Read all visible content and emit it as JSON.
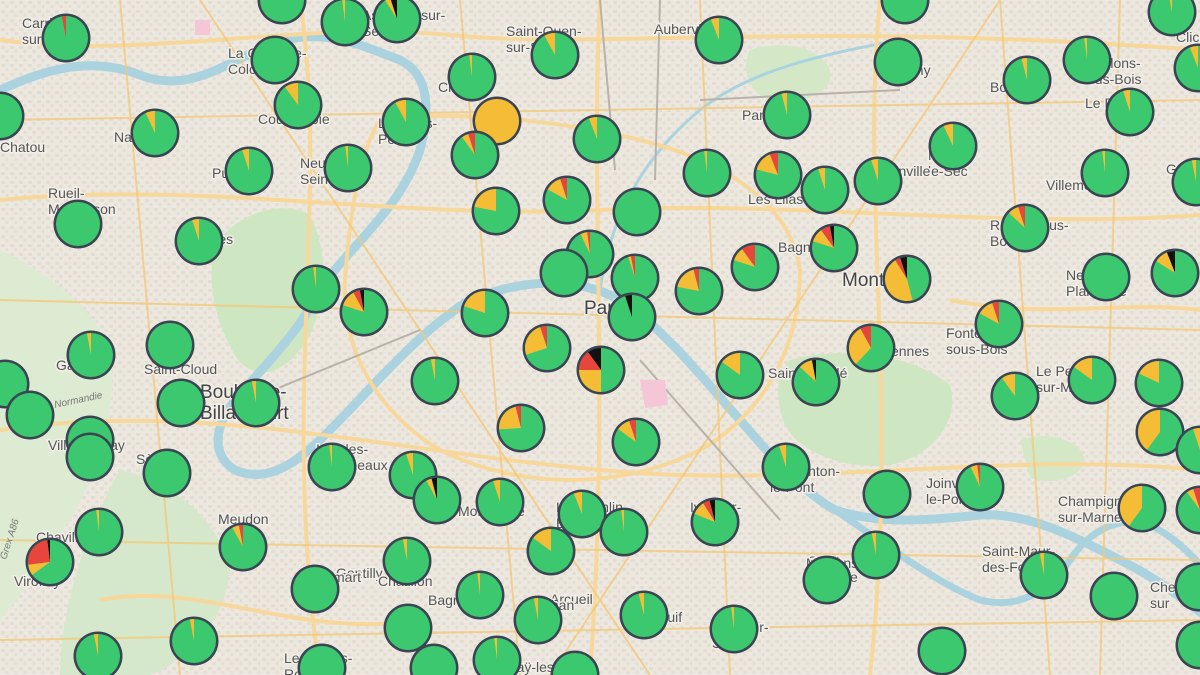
{
  "colors": {
    "ok": "#3cc86f",
    "warn": "#f5bd35",
    "bad": "#e8453c",
    "down": "#111111",
    "ring": "#3a4452"
  },
  "road_labels": [
    "Normandie",
    "Grex A86"
  ],
  "places": [
    {
      "name": "Carrières-sur-Seine",
      "lines": [
        "Carrières-",
        "sur-Seine"
      ]
    },
    {
      "name": "La Garenne-Colombes",
      "lines": [
        "La Garenne-",
        "Colombes"
      ]
    },
    {
      "name": "Asnières-sur-Seine",
      "lines": [
        "Asnières-sur-",
        "Seine"
      ]
    },
    {
      "name": "Saint-Ouen-sur-Seine",
      "lines": [
        "Saint-Ouen-",
        "sur-Seine"
      ]
    },
    {
      "name": "Aubervilliers",
      "lines": [
        "Aubervilliers"
      ]
    },
    {
      "name": "Livry",
      "lines": [
        "Livry"
      ]
    },
    {
      "name": "Clic",
      "lines": [
        "Clic"
      ]
    },
    {
      "name": "Les Pavillons-sous-Bois",
      "lines": [
        "Les",
        "Pavillons-",
        "sous-Bois"
      ]
    },
    {
      "name": "Bobigny",
      "lines": [
        "Bobigny"
      ]
    },
    {
      "name": "Bondy",
      "lines": [
        "Bondy"
      ]
    },
    {
      "name": "Le Raincy",
      "lines": [
        "Le Raincy"
      ]
    },
    {
      "name": "Courbevoie",
      "lines": [
        "Courbevoie"
      ]
    },
    {
      "name": "Levallois-Perret",
      "lines": [
        "Levallois-",
        "Perret"
      ]
    },
    {
      "name": "Clichy",
      "lines": [
        "Clichy"
      ]
    },
    {
      "name": "Pantin",
      "lines": [
        "Pantin"
      ]
    },
    {
      "name": "Noisy-le-Sec",
      "lines": [
        "Noisy-",
        "le-Sec"
      ]
    },
    {
      "name": "Romainville",
      "lines": [
        "Romainville"
      ]
    },
    {
      "name": "Villemomble",
      "lines": [
        "Villemomble"
      ]
    },
    {
      "name": "Gagny",
      "lines": [
        "Gag"
      ]
    },
    {
      "name": "Nanterre",
      "lines": [
        "Nanterre"
      ]
    },
    {
      "name": "Puteaux",
      "lines": [
        "Puteaux"
      ]
    },
    {
      "name": "Neuilly-sur-Seine",
      "lines": [
        "Neuilly-sur-",
        "Seine"
      ]
    },
    {
      "name": "Chatou",
      "lines": [
        "Chatou"
      ]
    },
    {
      "name": "Rueil-Malmaison",
      "lines": [
        "Rueil-",
        "Malmaison"
      ]
    },
    {
      "name": "Suresnes",
      "lines": [
        "Suresnes"
      ]
    },
    {
      "name": "Les Lilas",
      "lines": [
        "Les Lilas"
      ]
    },
    {
      "name": "Bagnolet",
      "lines": [
        "Bagnolet"
      ]
    },
    {
      "name": "Montreuil",
      "lines": [
        "Montreuil"
      ],
      "big": true
    },
    {
      "name": "Rosny-sous-Bois",
      "lines": [
        "Rosny-sous-",
        "Bois"
      ]
    },
    {
      "name": "Neuilly-Plaisance",
      "lines": [
        "Neuilly-",
        "Plaisance"
      ]
    },
    {
      "name": "Paris",
      "lines": [
        "Paris"
      ],
      "big": true
    },
    {
      "name": "Fontenay-sous-Bois",
      "lines": [
        "Fontenay-",
        "sous-Bois"
      ]
    },
    {
      "name": "Vincennes",
      "lines": [
        "Vincennes"
      ]
    },
    {
      "name": "Saint-Mandé",
      "lines": [
        "Saint-Mandé"
      ]
    },
    {
      "name": "Garches",
      "lines": [
        "Garches"
      ]
    },
    {
      "name": "Saint-Cloud",
      "lines": [
        "Saint-Cloud"
      ]
    },
    {
      "name": "Boulogne-Billancourt",
      "lines": [
        "Boulogne-",
        "Billancourt"
      ],
      "big": true
    },
    {
      "name": "Le Perreux-sur-Marne",
      "lines": [
        "Le Perreux-",
        "sur-Marne"
      ]
    },
    {
      "name": "Ville-d'Avray",
      "lines": [
        "Ville-d'Avray"
      ]
    },
    {
      "name": "Sèvres",
      "lines": [
        "Sèvres"
      ]
    },
    {
      "name": "Issy-les-Moulineaux",
      "lines": [
        "Issy-les-",
        "Moulineaux"
      ]
    },
    {
      "name": "Charenton-le-Pont",
      "lines": [
        "Charenton-",
        "le-Pont"
      ]
    },
    {
      "name": "Joinville-le-Pont",
      "lines": [
        "Joinville-",
        "le-Pont"
      ]
    },
    {
      "name": "Champigny-sur-Marne",
      "lines": [
        "Champigny-",
        "sur-Marne"
      ]
    },
    {
      "name": "Meudon",
      "lines": [
        "Meudon"
      ]
    },
    {
      "name": "Malakoff",
      "lines": [
        "Malakoff"
      ]
    },
    {
      "name": "Montrouge",
      "lines": [
        "Montrouge"
      ]
    },
    {
      "name": "Le Kremlin-Bicêtre",
      "lines": [
        "Le Kremlin-",
        "Bicêtre"
      ]
    },
    {
      "name": "Ivry-sur-Seine",
      "lines": [
        "Ivry-sur-",
        "Seine"
      ]
    },
    {
      "name": "Saint-Maurice",
      "lines": [
        "Saint-",
        "Maurice"
      ]
    },
    {
      "name": "Gentilly",
      "lines": [
        "Gentilly"
      ]
    },
    {
      "name": "Maisons-Alfort",
      "lines": [
        "Maisons-",
        "Alfort"
      ]
    },
    {
      "name": "Saint-Maur-des-Fossés",
      "lines": [
        "Saint-Maur-",
        "des-Fossés"
      ]
    },
    {
      "name": "Chennevières-sur-Marne",
      "lines": [
        "Che",
        "sur"
      ]
    },
    {
      "name": "Chaville",
      "lines": [
        "Chaville"
      ]
    },
    {
      "name": "Viroflay",
      "lines": [
        "Viroflay"
      ]
    },
    {
      "name": "Clamart",
      "lines": [
        "Clamart"
      ]
    },
    {
      "name": "Châtillon",
      "lines": [
        "Châtillon"
      ]
    },
    {
      "name": "Bagneux",
      "lines": [
        "Bagneux"
      ]
    },
    {
      "name": "Arcueil",
      "lines": [
        "Arcueil"
      ]
    },
    {
      "name": "Cachan",
      "lines": [
        "Cachan"
      ]
    },
    {
      "name": "Villejuif",
      "lines": [
        "Villejuif"
      ]
    },
    {
      "name": "Vitry-sur-Seine",
      "lines": [
        "Vitry-sur-",
        "Seine"
      ]
    },
    {
      "name": "Le Plessis-Robinson",
      "lines": [
        "Le Plessis-",
        "Robinson"
      ]
    },
    {
      "name": "L'Haÿ-les-Roses",
      "lines": [
        "L'Haÿ-les-",
        "Roses"
      ]
    }
  ],
  "markers": [
    {
      "id": "m1",
      "warn": 0.02,
      "bad": 0,
      "down": 0
    },
    {
      "id": "m2",
      "warn": 0.02,
      "bad": 0,
      "down": 0
    },
    {
      "id": "m3",
      "warn": 0.04,
      "bad": 0,
      "down": 0.05
    },
    {
      "id": "m4",
      "warn": 0.08,
      "bad": 0,
      "down": 0
    },
    {
      "id": "m5",
      "warn": 0.06,
      "bad": 0,
      "down": 0
    },
    {
      "id": "m6",
      "warn": 0,
      "bad": 0,
      "down": 0
    },
    {
      "id": "m7",
      "warn": 0.03,
      "bad": 0,
      "down": 0
    },
    {
      "id": "m8",
      "warn": 0.02,
      "bad": 0,
      "down": 0
    },
    {
      "id": "m9",
      "warn": 0.06,
      "bad": 0,
      "down": 0
    },
    {
      "id": "m10",
      "warn": 0.05,
      "bad": 0,
      "down": 0
    },
    {
      "id": "m11",
      "warn": 0.04,
      "bad": 0,
      "down": 0
    },
    {
      "id": "m12",
      "warn": 0,
      "bad": 0,
      "down": 0
    },
    {
      "id": "m13",
      "warn": 0.04,
      "bad": 0,
      "down": 0
    },
    {
      "id": "m14",
      "warn": 0.07,
      "bad": 0,
      "down": 0
    },
    {
      "id": "m15",
      "warn": 0.06,
      "bad": 0,
      "down": 0
    },
    {
      "id": "m16",
      "warn": 0.02,
      "bad": 0,
      "down": 0
    },
    {
      "id": "m17",
      "warn": 1,
      "bad": 0,
      "down": 0
    },
    {
      "id": "m18",
      "warn": 0.08,
      "bad": 0,
      "down": 0
    },
    {
      "id": "m19",
      "warn": 0.1,
      "bad": 0,
      "down": 0
    },
    {
      "id": "m20",
      "warn": 0,
      "bad": 0,
      "down": 0
    },
    {
      "id": "m21",
      "warn": 0,
      "bad": 0.03,
      "down": 0
    },
    {
      "id": "m22",
      "warn": 0.07,
      "bad": 0,
      "down": 0
    },
    {
      "id": "m23",
      "warn": 0.05,
      "bad": 0,
      "down": 0
    },
    {
      "id": "m24",
      "warn": 0.02,
      "bad": 0,
      "down": 0
    },
    {
      "id": "m25",
      "warn": 0.05,
      "bad": 0.05,
      "down": 0
    },
    {
      "id": "m26",
      "warn": 0.12,
      "bad": 0.05,
      "down": 0
    },
    {
      "id": "m27",
      "warn": 0.22,
      "bad": 0,
      "down": 0
    },
    {
      "id": "m28",
      "warn": 0,
      "bad": 0,
      "down": 0
    },
    {
      "id": "m29",
      "warn": 0.02,
      "bad": 0,
      "down": 0
    },
    {
      "id": "m30",
      "warn": 0.15,
      "bad": 0.06,
      "down": 0
    },
    {
      "id": "m31",
      "warn": 0.05,
      "bad": 0,
      "down": 0
    },
    {
      "id": "m32",
      "warn": 0.05,
      "bad": 0,
      "down": 0
    },
    {
      "id": "m33",
      "warn": 0.02,
      "bad": 0,
      "down": 0
    },
    {
      "id": "m34",
      "warn": 0.08,
      "bad": 0.05,
      "down": 0
    },
    {
      "id": "m35",
      "warn": 0.03,
      "bad": 0,
      "down": 0
    },
    {
      "id": "m36",
      "warn": 0,
      "bad": 0,
      "down": 0
    },
    {
      "id": "m37",
      "warn": 0.1,
      "bad": 0,
      "down": 0.06
    },
    {
      "id": "m38",
      "warn": 0.1,
      "bad": 0.07,
      "down": 0.03
    },
    {
      "id": "m39",
      "warn": 0.45,
      "bad": 0.04,
      "down": 0.05
    },
    {
      "id": "m40",
      "warn": 0.1,
      "bad": 0.1,
      "down": 0
    },
    {
      "id": "m41",
      "warn": 0.18,
      "bad": 0.04,
      "down": 0
    },
    {
      "id": "m42",
      "warn": 0.02,
      "bad": 0.03,
      "down": 0
    },
    {
      "id": "m43",
      "warn": 0.05,
      "bad": 0.02,
      "down": 0
    },
    {
      "id": "m44",
      "warn": 0,
      "bad": 0,
      "down": 0
    },
    {
      "id": "m45",
      "warn": 0,
      "bad": 0,
      "down": 0.05
    },
    {
      "id": "m46",
      "warn": 0.02,
      "bad": 0,
      "down": 0
    },
    {
      "id": "m47",
      "warn": 0.05,
      "bad": 0,
      "down": 0
    },
    {
      "id": "m48",
      "warn": 0,
      "bad": 0,
      "down": 0
    },
    {
      "id": "m49",
      "warn": 0.05,
      "bad": 0.06,
      "down": 0
    },
    {
      "id": "m50",
      "warn": 0.12,
      "bad": 0.05,
      "down": 0.03
    },
    {
      "id": "m51",
      "warn": 0.2,
      "bad": 0,
      "down": 0
    },
    {
      "id": "m52",
      "warn": 0.25,
      "bad": 0.05,
      "down": 0
    },
    {
      "id": "m53",
      "warn": 0.25,
      "bad": 0.15,
      "down": 0.1
    },
    {
      "id": "m54",
      "warn": 0.15,
      "bad": 0,
      "down": 0
    },
    {
      "id": "m55",
      "warn": 0.1,
      "bad": 0,
      "down": 0.03
    },
    {
      "id": "m56",
      "warn": 0.3,
      "bad": 0.08,
      "down": 0
    },
    {
      "id": "m57",
      "warn": 0.12,
      "bad": 0.05,
      "down": 0
    },
    {
      "id": "m58",
      "warn": 0.15,
      "bad": 0,
      "down": 0
    },
    {
      "id": "m59",
      "warn": 0.18,
      "bad": 0,
      "down": 0
    },
    {
      "id": "m60",
      "warn": 0.1,
      "bad": 0,
      "down": 0
    },
    {
      "id": "m61",
      "warn": 0.4,
      "bad": 0,
      "down": 0
    },
    {
      "id": "m62",
      "warn": 0.05,
      "bad": 0,
      "down": 0
    },
    {
      "id": "m63",
      "warn": 0.03,
      "bad": 0,
      "down": 0
    },
    {
      "id": "m64",
      "warn": 0,
      "bad": 0,
      "down": 0
    },
    {
      "id": "m65",
      "warn": 0.03,
      "bad": 0,
      "down": 0
    },
    {
      "id": "m66",
      "warn": 0,
      "bad": 0,
      "down": 0
    },
    {
      "id": "m67",
      "warn": 0,
      "bad": 0,
      "down": 0
    },
    {
      "id": "m68",
      "warn": 0,
      "bad": 0,
      "down": 0
    },
    {
      "id": "m69",
      "warn": 0.03,
      "bad": 0,
      "down": 0
    },
    {
      "id": "m70",
      "warn": 0,
      "bad": 0,
      "down": 0
    },
    {
      "id": "m71",
      "warn": 0,
      "bad": 0,
      "down": 0
    },
    {
      "id": "m72",
      "warn": 0,
      "bad": 0,
      "down": 0
    },
    {
      "id": "m73",
      "warn": 0.02,
      "bad": 0,
      "down": 0
    },
    {
      "id": "m74",
      "warn": 0.05,
      "bad": 0,
      "down": 0
    },
    {
      "id": "m75",
      "warn": 0.04,
      "bad": 0,
      "down": 0.04
    },
    {
      "id": "m76",
      "warn": 0.05,
      "bad": 0,
      "down": 0
    },
    {
      "id": "m77",
      "warn": 0.06,
      "bad": 0,
      "down": 0
    },
    {
      "id": "m78",
      "warn": 0.22,
      "bad": 0.04,
      "down": 0
    },
    {
      "id": "m79",
      "warn": 0.1,
      "bad": 0.05,
      "down": 0
    },
    {
      "id": "m80",
      "warn": 0.05,
      "bad": 0,
      "down": 0
    },
    {
      "id": "m81",
      "warn": 0,
      "bad": 0,
      "down": 0
    },
    {
      "id": "m82",
      "warn": 0.05,
      "bad": 0.02,
      "down": 0
    },
    {
      "id": "m83",
      "warn": 0.4,
      "bad": 0,
      "down": 0
    },
    {
      "id": "m84",
      "warn": 0.05,
      "bad": 0.05,
      "down": 0
    },
    {
      "id": "m85",
      "warn": 0.1,
      "bad": 0.05,
      "down": 0.04
    },
    {
      "id": "m86",
      "warn": 0.02,
      "bad": 0,
      "down": 0
    },
    {
      "id": "m87",
      "warn": 0.15,
      "bad": 0,
      "down": 0
    },
    {
      "id": "m88",
      "warn": 0.03,
      "bad": 0,
      "down": 0
    },
    {
      "id": "m89",
      "warn": 0.05,
      "bad": 0.03,
      "down": 0
    },
    {
      "id": "m90",
      "warn": 0.02,
      "bad": 0,
      "down": 0
    },
    {
      "id": "m91",
      "warn": 0.08,
      "bad": 0.25,
      "down": 0.02
    },
    {
      "id": "m92",
      "warn": 0.03,
      "bad": 0,
      "down": 0
    },
    {
      "id": "m93",
      "warn": 0.03,
      "bad": 0,
      "down": 0
    },
    {
      "id": "m94",
      "warn": 0,
      "bad": 0,
      "down": 0
    },
    {
      "id": "m95",
      "warn": 0,
      "bad": 0,
      "down": 0
    },
    {
      "id": "m96",
      "warn": 0.02,
      "bad": 0,
      "down": 0
    },
    {
      "id": "m97",
      "warn": 0.03,
      "bad": 0,
      "down": 0
    },
    {
      "id": "m98",
      "warn": 0.04,
      "bad": 0,
      "down": 0
    },
    {
      "id": "m99",
      "warn": 0.02,
      "bad": 0,
      "down": 0
    },
    {
      "id": "m100",
      "warn": 0,
      "bad": 0,
      "down": 0
    },
    {
      "id": "m101",
      "warn": 0.03,
      "bad": 0,
      "down": 0
    },
    {
      "id": "m102",
      "warn": 0,
      "bad": 0,
      "down": 0
    },
    {
      "id": "m103",
      "warn": 0.03,
      "bad": 0,
      "down": 0
    },
    {
      "id": "m104",
      "warn": 0,
      "bad": 0,
      "down": 0
    },
    {
      "id": "m105",
      "warn": 0,
      "bad": 0,
      "down": 0
    },
    {
      "id": "m106",
      "warn": 0,
      "bad": 0,
      "down": 0
    },
    {
      "id": "m107",
      "warn": 0,
      "bad": 0,
      "down": 0
    },
    {
      "id": "m108",
      "warn": 0,
      "bad": 0,
      "down": 0
    },
    {
      "id": "m109",
      "warn": 0.02,
      "bad": 0,
      "down": 0
    },
    {
      "id": "m110",
      "warn": 0,
      "bad": 0,
      "down": 0
    },
    {
      "id": "m111",
      "warn": 0,
      "bad": 0,
      "down": 0
    },
    {
      "id": "m112",
      "warn": 0,
      "bad": 0,
      "down": 0
    },
    {
      "id": "m113",
      "warn": 0,
      "bad": 0,
      "down": 0
    }
  ]
}
